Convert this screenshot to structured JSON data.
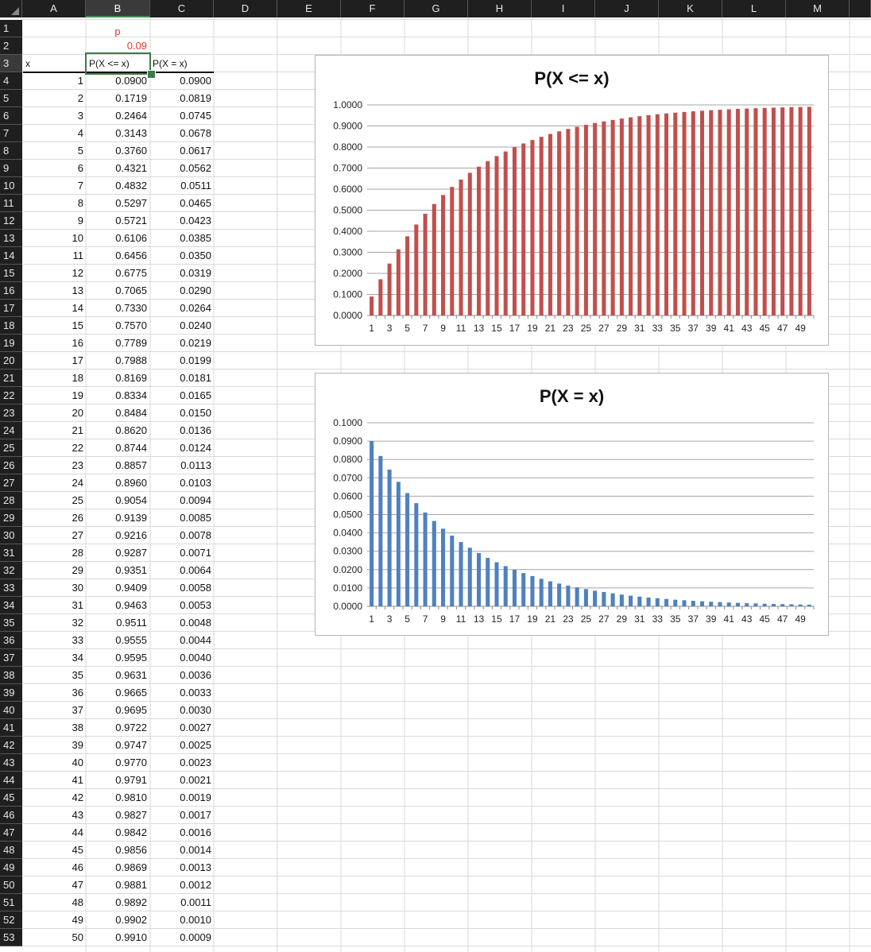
{
  "columns": [
    "A",
    "B",
    "C",
    "D",
    "E",
    "F",
    "G",
    "H",
    "I",
    "J",
    "K",
    "L",
    "M"
  ],
  "selected_column": "B",
  "selected_row": 3,
  "param": {
    "label": "p",
    "value": "0.09"
  },
  "headers": {
    "x": "x",
    "cdf": "P(X <= x)",
    "pmf": "P(X = x)"
  },
  "rows": [
    {
      "x": "1",
      "cdf": "0.0900",
      "pmf": "0.0900"
    },
    {
      "x": "2",
      "cdf": "0.1719",
      "pmf": "0.0819"
    },
    {
      "x": "3",
      "cdf": "0.2464",
      "pmf": "0.0745"
    },
    {
      "x": "4",
      "cdf": "0.3143",
      "pmf": "0.0678"
    },
    {
      "x": "5",
      "cdf": "0.3760",
      "pmf": "0.0617"
    },
    {
      "x": "6",
      "cdf": "0.4321",
      "pmf": "0.0562"
    },
    {
      "x": "7",
      "cdf": "0.4832",
      "pmf": "0.0511"
    },
    {
      "x": "8",
      "cdf": "0.5297",
      "pmf": "0.0465"
    },
    {
      "x": "9",
      "cdf": "0.5721",
      "pmf": "0.0423"
    },
    {
      "x": "10",
      "cdf": "0.6106",
      "pmf": "0.0385"
    },
    {
      "x": "11",
      "cdf": "0.6456",
      "pmf": "0.0350"
    },
    {
      "x": "12",
      "cdf": "0.6775",
      "pmf": "0.0319"
    },
    {
      "x": "13",
      "cdf": "0.7065",
      "pmf": "0.0290"
    },
    {
      "x": "14",
      "cdf": "0.7330",
      "pmf": "0.0264"
    },
    {
      "x": "15",
      "cdf": "0.7570",
      "pmf": "0.0240"
    },
    {
      "x": "16",
      "cdf": "0.7789",
      "pmf": "0.0219"
    },
    {
      "x": "17",
      "cdf": "0.7988",
      "pmf": "0.0199"
    },
    {
      "x": "18",
      "cdf": "0.8169",
      "pmf": "0.0181"
    },
    {
      "x": "19",
      "cdf": "0.8334",
      "pmf": "0.0165"
    },
    {
      "x": "20",
      "cdf": "0.8484",
      "pmf": "0.0150"
    },
    {
      "x": "21",
      "cdf": "0.8620",
      "pmf": "0.0136"
    },
    {
      "x": "22",
      "cdf": "0.8744",
      "pmf": "0.0124"
    },
    {
      "x": "23",
      "cdf": "0.8857",
      "pmf": "0.0113"
    },
    {
      "x": "24",
      "cdf": "0.8960",
      "pmf": "0.0103"
    },
    {
      "x": "25",
      "cdf": "0.9054",
      "pmf": "0.0094"
    },
    {
      "x": "26",
      "cdf": "0.9139",
      "pmf": "0.0085"
    },
    {
      "x": "27",
      "cdf": "0.9216",
      "pmf": "0.0078"
    },
    {
      "x": "28",
      "cdf": "0.9287",
      "pmf": "0.0071"
    },
    {
      "x": "29",
      "cdf": "0.9351",
      "pmf": "0.0064"
    },
    {
      "x": "30",
      "cdf": "0.9409",
      "pmf": "0.0058"
    },
    {
      "x": "31",
      "cdf": "0.9463",
      "pmf": "0.0053"
    },
    {
      "x": "32",
      "cdf": "0.9511",
      "pmf": "0.0048"
    },
    {
      "x": "33",
      "cdf": "0.9555",
      "pmf": "0.0044"
    },
    {
      "x": "34",
      "cdf": "0.9595",
      "pmf": "0.0040"
    },
    {
      "x": "35",
      "cdf": "0.9631",
      "pmf": "0.0036"
    },
    {
      "x": "36",
      "cdf": "0.9665",
      "pmf": "0.0033"
    },
    {
      "x": "37",
      "cdf": "0.9695",
      "pmf": "0.0030"
    },
    {
      "x": "38",
      "cdf": "0.9722",
      "pmf": "0.0027"
    },
    {
      "x": "39",
      "cdf": "0.9747",
      "pmf": "0.0025"
    },
    {
      "x": "40",
      "cdf": "0.9770",
      "pmf": "0.0023"
    },
    {
      "x": "41",
      "cdf": "0.9791",
      "pmf": "0.0021"
    },
    {
      "x": "42",
      "cdf": "0.9810",
      "pmf": "0.0019"
    },
    {
      "x": "43",
      "cdf": "0.9827",
      "pmf": "0.0017"
    },
    {
      "x": "44",
      "cdf": "0.9842",
      "pmf": "0.0016"
    },
    {
      "x": "45",
      "cdf": "0.9856",
      "pmf": "0.0014"
    },
    {
      "x": "46",
      "cdf": "0.9869",
      "pmf": "0.0013"
    },
    {
      "x": "47",
      "cdf": "0.9881",
      "pmf": "0.0012"
    },
    {
      "x": "48",
      "cdf": "0.9892",
      "pmf": "0.0011"
    },
    {
      "x": "49",
      "cdf": "0.9902",
      "pmf": "0.0010"
    },
    {
      "x": "50",
      "cdf": "0.9910",
      "pmf": "0.0009"
    }
  ],
  "colors": {
    "cdf_bar": "#c0504d",
    "pmf_bar": "#4f81bd",
    "selection": "#3d7a4a",
    "param_text": "#e23a2e"
  },
  "chart_data": [
    {
      "type": "bar",
      "title": "P(X <= x)",
      "categories": [
        1,
        2,
        3,
        4,
        5,
        6,
        7,
        8,
        9,
        10,
        11,
        12,
        13,
        14,
        15,
        16,
        17,
        18,
        19,
        20,
        21,
        22,
        23,
        24,
        25,
        26,
        27,
        28,
        29,
        30,
        31,
        32,
        33,
        34,
        35,
        36,
        37,
        38,
        39,
        40,
        41,
        42,
        43,
        44,
        45,
        46,
        47,
        48,
        49,
        50
      ],
      "values": [
        0.09,
        0.1719,
        0.2464,
        0.3143,
        0.376,
        0.4321,
        0.4832,
        0.5297,
        0.5721,
        0.6106,
        0.6456,
        0.6775,
        0.7065,
        0.733,
        0.757,
        0.7789,
        0.7988,
        0.8169,
        0.8334,
        0.8484,
        0.862,
        0.8744,
        0.8857,
        0.896,
        0.9054,
        0.9139,
        0.9216,
        0.9287,
        0.9351,
        0.9409,
        0.9463,
        0.9511,
        0.9555,
        0.9595,
        0.9631,
        0.9665,
        0.9695,
        0.9722,
        0.9747,
        0.977,
        0.9791,
        0.981,
        0.9827,
        0.9842,
        0.9856,
        0.9869,
        0.9881,
        0.9892,
        0.9902,
        0.991
      ],
      "ylim": [
        0,
        1
      ],
      "yticks": [
        "0.0000",
        "0.1000",
        "0.2000",
        "0.3000",
        "0.4000",
        "0.5000",
        "0.6000",
        "0.7000",
        "0.8000",
        "0.9000",
        "1.0000"
      ],
      "xticks": [
        "1",
        "3",
        "5",
        "7",
        "9",
        "11",
        "13",
        "15",
        "17",
        "19",
        "21",
        "23",
        "25",
        "27",
        "29",
        "31",
        "33",
        "35",
        "37",
        "39",
        "41",
        "43",
        "45",
        "47",
        "49"
      ],
      "grid": true,
      "legend": "none"
    },
    {
      "type": "bar",
      "title": "P(X = x)",
      "categories": [
        1,
        2,
        3,
        4,
        5,
        6,
        7,
        8,
        9,
        10,
        11,
        12,
        13,
        14,
        15,
        16,
        17,
        18,
        19,
        20,
        21,
        22,
        23,
        24,
        25,
        26,
        27,
        28,
        29,
        30,
        31,
        32,
        33,
        34,
        35,
        36,
        37,
        38,
        39,
        40,
        41,
        42,
        43,
        44,
        45,
        46,
        47,
        48,
        49,
        50
      ],
      "values": [
        0.09,
        0.0819,
        0.0745,
        0.0678,
        0.0617,
        0.0562,
        0.0511,
        0.0465,
        0.0423,
        0.0385,
        0.035,
        0.0319,
        0.029,
        0.0264,
        0.024,
        0.0219,
        0.0199,
        0.0181,
        0.0165,
        0.015,
        0.0136,
        0.0124,
        0.0113,
        0.0103,
        0.0094,
        0.0085,
        0.0078,
        0.0071,
        0.0064,
        0.0058,
        0.0053,
        0.0048,
        0.0044,
        0.004,
        0.0036,
        0.0033,
        0.003,
        0.0027,
        0.0025,
        0.0023,
        0.0021,
        0.0019,
        0.0017,
        0.0016,
        0.0014,
        0.0013,
        0.0012,
        0.0011,
        0.001,
        0.0009
      ],
      "ylim": [
        0,
        0.1
      ],
      "yticks": [
        "0.0000",
        "0.0100",
        "0.0200",
        "0.0300",
        "0.0400",
        "0.0500",
        "0.0600",
        "0.0700",
        "0.0800",
        "0.0900",
        "0.1000"
      ],
      "xticks": [
        "1",
        "3",
        "5",
        "7",
        "9",
        "11",
        "13",
        "15",
        "17",
        "19",
        "21",
        "23",
        "25",
        "27",
        "29",
        "31",
        "33",
        "35",
        "37",
        "39",
        "41",
        "43",
        "45",
        "47",
        "49"
      ],
      "grid": true,
      "legend": "none"
    }
  ]
}
